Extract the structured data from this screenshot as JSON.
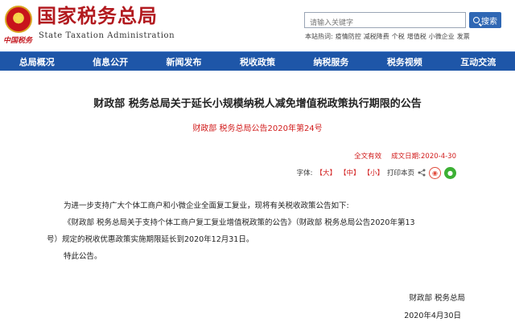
{
  "header": {
    "logo_cn": "国家税务总局",
    "logo_en": "State Taxation Administration",
    "slogan": "中国税务"
  },
  "search": {
    "placeholder": "请输入关键字",
    "button_label": "搜索",
    "hot_label": "本站热词:",
    "hot_words": [
      "疫情防控",
      "减税降费",
      "个税",
      "增值税",
      "小微企业",
      "发票"
    ]
  },
  "nav": {
    "items": [
      "总局概况",
      "信息公开",
      "新闻发布",
      "税收政策",
      "纳税服务",
      "税务视频",
      "互动交流"
    ]
  },
  "article": {
    "title": "财政部 税务总局关于延长小规模纳税人减免增值税政策执行期限的公告",
    "subtitle": "财政部 税务总局公告2020年第24号",
    "validity": "全文有效",
    "date_label": "成文日期:",
    "date": "2020-4-30",
    "font_label": "字体:",
    "font_large": "【大】",
    "font_medium": "【中】",
    "font_small": "【小】",
    "print_label": "打印本页",
    "para1": "为进一步支持广大个体工商户和小微企业全面复工复业，现将有关税收政策公告如下:",
    "para2": "《财政部 税务总局关于支持个体工商户复工复业增值税政策的公告》（财政部 税务总局公告2020年第13",
    "para3": "号）规定的税收优惠政策实施期限延长到2020年12月31日。",
    "para4": "特此公告。",
    "sign_org": "财政部  税务总局",
    "sign_date": "2020年4月30日"
  },
  "icons": {
    "share": "share-icon",
    "weibo": "weibo-icon",
    "wechat": "wechat-icon",
    "search": "search-icon",
    "emblem": "emblem-icon"
  },
  "colors": {
    "brand_red": "#b21a1f",
    "nav_blue": "#1e56a8",
    "accent_red": "#d11b1b",
    "wechat_green": "#3cb034"
  }
}
